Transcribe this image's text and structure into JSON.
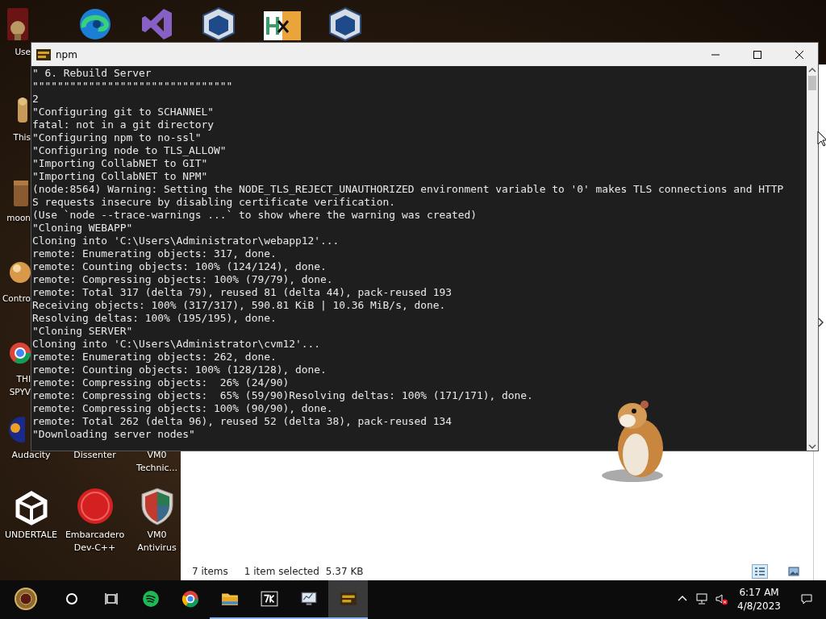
{
  "desktop_icons": [
    {
      "kind": "cut",
      "lines": [
        "Use"
      ]
    },
    {
      "kind": "icon-only"
    },
    {
      "kind": "icon-only"
    },
    {
      "kind": "icon-only"
    },
    {
      "kind": "icon-only"
    },
    {
      "kind": "icon-only"
    },
    {
      "kind": "cut",
      "lines": [
        "This"
      ]
    },
    {
      "kind": "cut",
      "lines": [
        "moon"
      ]
    },
    {
      "kind": "cut",
      "lines": [
        "Contro"
      ]
    },
    {
      "kind": "cut",
      "lines": [
        "THI",
        "SPYV"
      ]
    },
    {
      "kind": "peek",
      "lines": [
        "Audacity"
      ]
    },
    {
      "kind": "label-only",
      "lines": [
        "Dissenter"
      ]
    },
    {
      "kind": "label-only",
      "lines": [
        "VM0",
        "Technic..."
      ]
    },
    {
      "kind": "full",
      "lines": [
        "UNDERTALE"
      ]
    },
    {
      "kind": "full",
      "lines": [
        "Embarcadero",
        "Dev-C++"
      ]
    },
    {
      "kind": "full",
      "lines": [
        "VM0",
        "Antivirus"
      ]
    }
  ],
  "terminal": {
    "title": "npm",
    "lines": [
      "\" 6. Rebuild Server",
      "\"\"\"\"\"\"\"\"\"\"\"\"\"\"\"\"\"\"\"\"\"\"\"\"\"\"\"\"\"\"\"\"",
      "2",
      "\"Configuring git to SCHANNEL\"",
      "fatal: not in a git directory",
      "\"Configuring npm to no-ssl\"",
      "\"Configuring node to TLS_ALLOW\"",
      "\"Importing CollabNET to GIT\"",
      "\"Importing CollabNET to NPM\"",
      "(node:8564) Warning: Setting the NODE_TLS_REJECT_UNAUTHORIZED environment variable to '0' makes TLS connections and HTTP",
      "S requests insecure by disabling certificate verification.",
      "(Use `node --trace-warnings ...` to show where the warning was created)",
      "\"Cloning WEBAPP\"",
      "Cloning into 'C:\\Users\\Administrator\\webapp12'...",
      "remote: Enumerating objects: 317, done.",
      "remote: Counting objects: 100% (124/124), done.",
      "remote: Compressing objects: 100% (79/79), done.",
      "remote: Total 317 (delta 79), reused 81 (delta 44), pack-reused 193",
      "Receiving objects: 100% (317/317), 590.81 KiB | 10.36 MiB/s, done.",
      "Resolving deltas: 100% (195/195), done.",
      "\"Cloning SERVER\"",
      "Cloning into 'C:\\Users\\Administrator\\cvm12'...",
      "remote: Enumerating objects: 262, done.",
      "remote: Counting objects: 100% (128/128), done.",
      "remote: Compressing objects:  26% (24/90)",
      "remote: Compressing objects:  65% (59/90)Resolving deltas: 100% (171/171), done.",
      "remote: Compressing objects: 100% (90/90), done.",
      "remote: Total 262 (delta 96), reused 52 (delta 38), pack-reused 134",
      "\"Downloading server nodes\""
    ]
  },
  "explorer": {
    "status": {
      "item_count": "7 items",
      "selection": "1 item selected",
      "selection_size": "5.37 KB"
    },
    "views": [
      {
        "selected": true
      },
      {
        "selected": false
      }
    ]
  },
  "taskbar": {
    "apps": [
      {
        "running": false,
        "selected": false
      },
      {
        "running": false,
        "selected": false
      },
      {
        "running": true,
        "selected": false
      },
      {
        "running": true,
        "selected": false
      },
      {
        "running": true,
        "selected": false
      },
      {
        "running": true,
        "selected": true
      }
    ],
    "clock": {
      "time": "6:17 AM",
      "date": "4/8/2023"
    }
  }
}
